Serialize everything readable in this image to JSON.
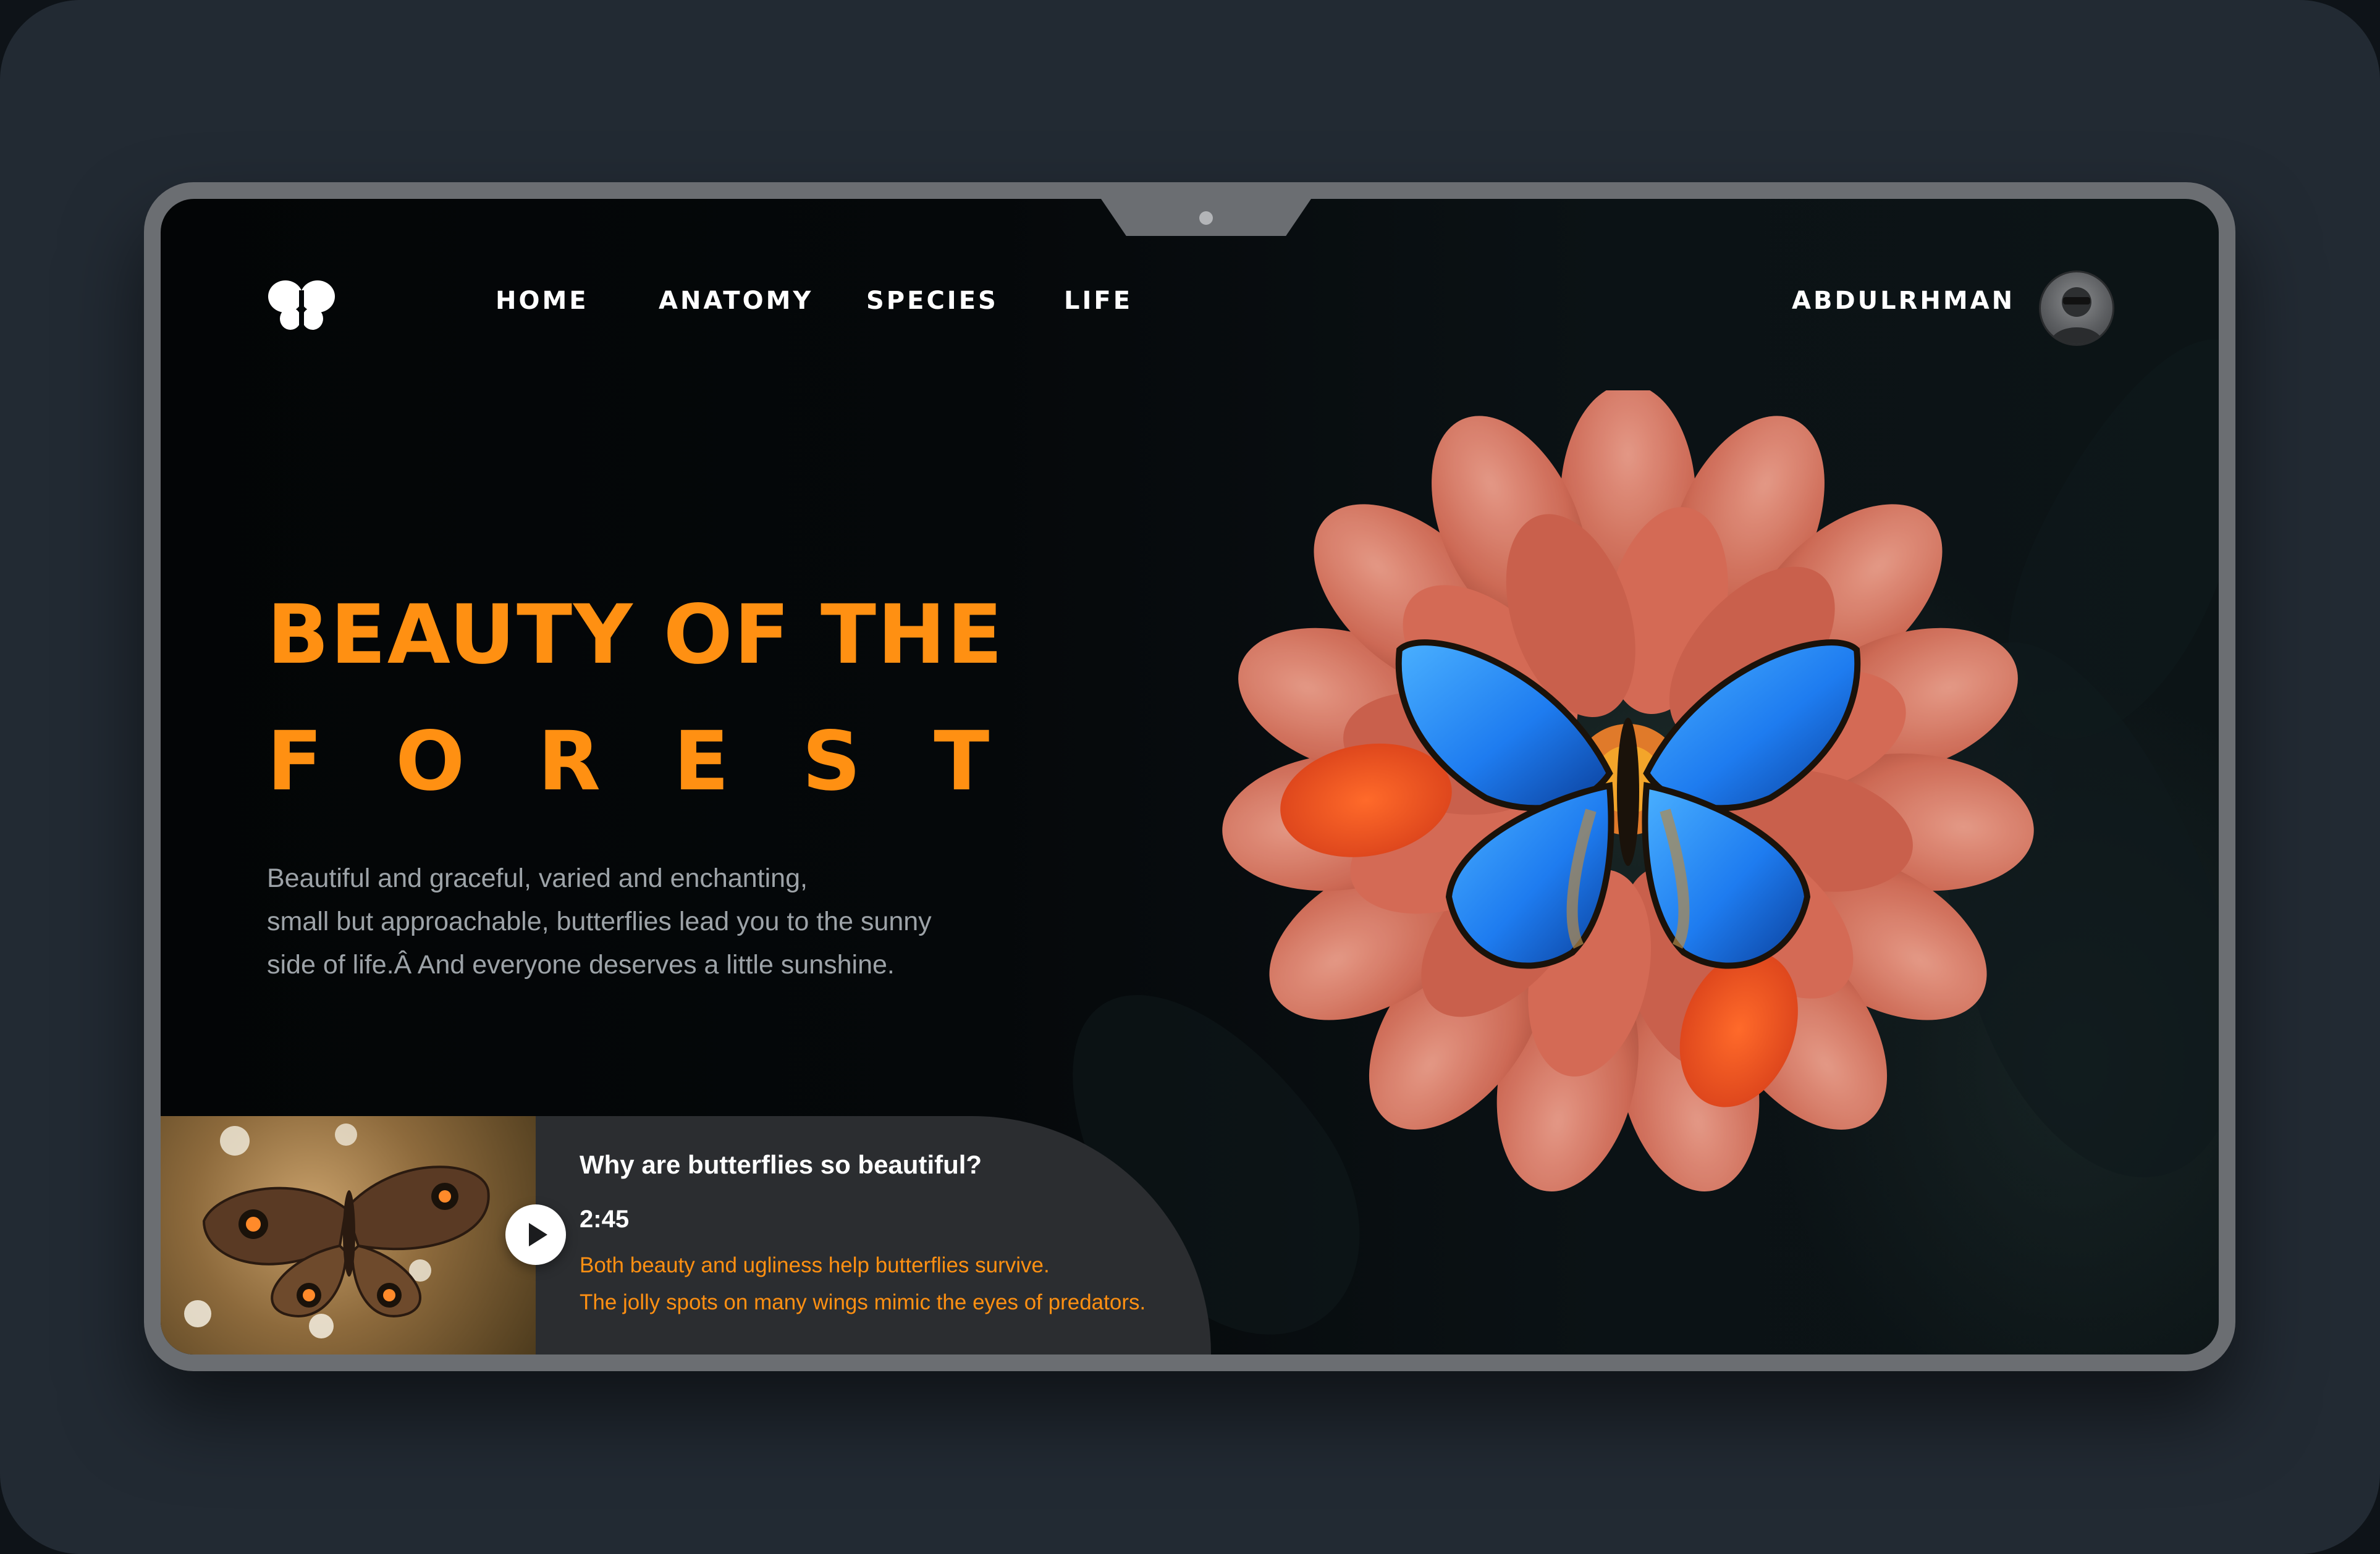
{
  "nav": {
    "items": [
      {
        "label": "HOME"
      },
      {
        "label": "ANATOMY"
      },
      {
        "label": "SPECIES"
      },
      {
        "label": "LIFE"
      }
    ],
    "user_name": "ABDULRHMAN"
  },
  "hero": {
    "title_line_1": "BEAUTY OF THE",
    "title_line_2": "FOREST",
    "description_lines": [
      "Beautiful and graceful, varied and enchanting,",
      "small but approachable, butterflies lead you to the sunny",
      "side of life.Â And everyone deserves a little sunshine."
    ]
  },
  "video": {
    "title": "Why are butterflies so beautiful?",
    "duration": "2:45",
    "lines": [
      "Both beauty and ugliness help butterflies survive.",
      "The jolly spots on many wings mimic the eyes of predators."
    ]
  },
  "colors": {
    "accent": "#ff9012",
    "background": "#222a33",
    "screen": "#05080a",
    "frame": "#6b6e72",
    "card": "#2b2d30",
    "butterfly_blue": "#1e88ff",
    "flower": "#d9705a"
  },
  "icons": {
    "logo": "butterfly-logo-icon",
    "play": "play-icon"
  }
}
